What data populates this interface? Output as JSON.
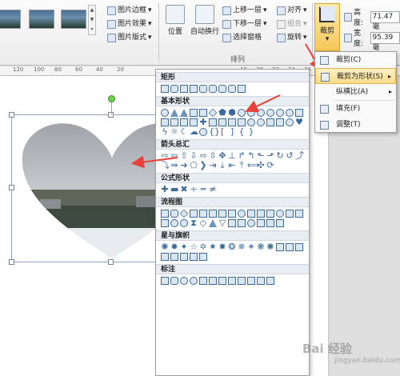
{
  "ribbon": {
    "picture_border": "图片边框",
    "picture_effects": "图片效果",
    "picture_layout": "图片版式",
    "position": "位置",
    "wrap_text": "自动换行",
    "bring_forward": "上移一层",
    "send_backward": "下移一层",
    "selection_pane": "选择窗格",
    "align": "对齐",
    "group": "组合",
    "rotate": "旋转",
    "arrange_group": "排列",
    "crop": "裁剪",
    "height_label": "高度:",
    "height_value": "71.47 毫",
    "width_label": "宽度:",
    "width_value": "95.39 毫"
  },
  "ruler": {
    "marks": [
      "120",
      "100",
      "80",
      "60",
      "40",
      "20",
      "18",
      "20",
      "22",
      "24",
      "26",
      "28",
      "30",
      "32"
    ]
  },
  "crop_menu": {
    "items": [
      "裁剪(C)",
      "裁剪为形状(S)",
      "纵横比(A)",
      "填充(F)",
      "调整(T)"
    ],
    "submenu_arrow": "▸"
  },
  "shape_panel": {
    "categories": [
      "矩形",
      "基本形状",
      "箭头总汇",
      "公式形状",
      "流程图",
      "星与旗帜",
      "标注"
    ]
  },
  "watermark": {
    "brand": "Bai 经验",
    "url": "jingyan.baidu.com"
  },
  "colors": {
    "accent_arrow": "#e8403a",
    "highlight": "#f9dc8a"
  }
}
